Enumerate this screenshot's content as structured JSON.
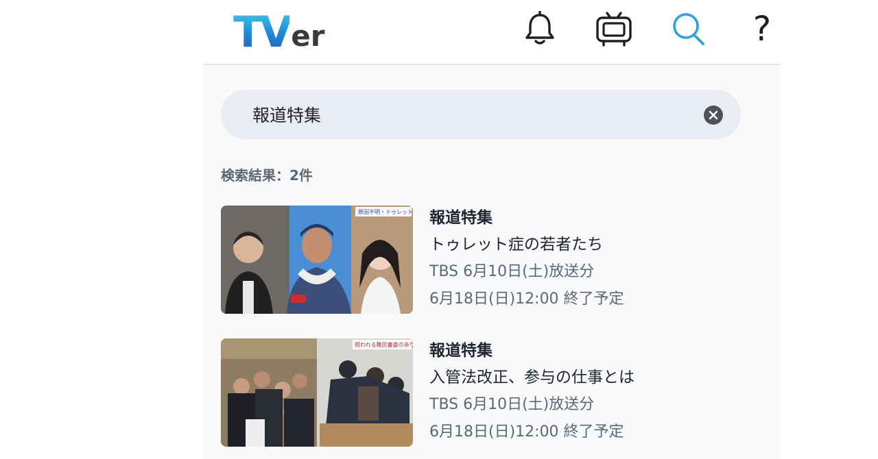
{
  "header": {
    "logo_text_main": "TV",
    "logo_text_sub": "er",
    "icons": {
      "notifications": "bell-icon",
      "tv": "tv-icon",
      "search": "search-icon",
      "help": "?"
    }
  },
  "search": {
    "query": "報道特集",
    "clear_icon": "close-circle-icon"
  },
  "results": {
    "count_label": "検索結果：2件",
    "items": [
      {
        "program": "報道特集",
        "episode": "トゥレット症の若者たち",
        "broadcast": "TBS 6月10日(土)放送分",
        "expiry": "6月18日(日)12:00 終了予定",
        "thumb_caption": "原因不明・トゥレット症とは"
      },
      {
        "program": "報道特集",
        "episode": "入管法改正、参与の仕事とは",
        "broadcast": "TBS 6月10日(土)放送分",
        "expiry": "6月18日(日)12:00 終了予定",
        "thumb_caption": "問われる難民審査のあり方"
      }
    ]
  },
  "colors": {
    "accent": "#29a3e0",
    "text_primary": "#1f2430",
    "text_secondary": "#5e6574",
    "search_bg": "#e9ecf3"
  }
}
